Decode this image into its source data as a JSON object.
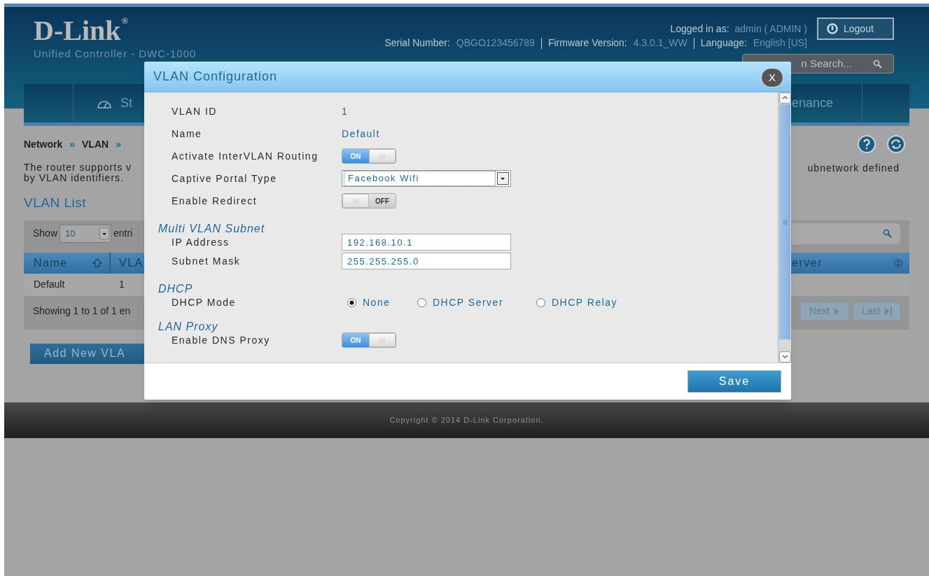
{
  "header": {
    "logo": "D-Link",
    "logo_mark": "®",
    "product": "Unified Controller - DWC-1000",
    "logged_in_label": "Logged in as:",
    "logged_in_value": "admin ( ADMIN )",
    "logout": "Logout",
    "info": [
      {
        "label": "Serial Number:",
        "value": "QBGO123456789"
      },
      {
        "label": "Firmware Version:",
        "value": "4.3.0.1_WW"
      },
      {
        "label": "Language:",
        "value": "English [US]"
      }
    ],
    "search_placeholder": "n Search..."
  },
  "nav": [
    {
      "kind": "left",
      "label": "St"
    },
    {
      "kind": "right",
      "label": "enance"
    }
  ],
  "breadcrumb": [
    "Network",
    "»",
    "VLAN",
    "»"
  ],
  "description": {
    "left_lines": [
      "The router supports v",
      "by VLAN identifiers."
    ],
    "right_line": "ubnetwork defined"
  },
  "list_title": "VLAN List",
  "table": {
    "show_label": "Show",
    "page_size": "10",
    "entries_label": "entri",
    "columns": [
      {
        "label": "Name",
        "kind": "ascending"
      },
      {
        "label": "VLA",
        "kind": "plain"
      },
      {
        "label": "erver",
        "kind": "sortable"
      }
    ],
    "rows": [
      [
        "Default",
        "1"
      ]
    ],
    "info": "Showing 1 to 1 of 1 en",
    "pager": [
      "Next",
      "Last"
    ]
  },
  "add_button": "Add New VLA",
  "modal": {
    "title": "VLAN Configuration",
    "close": "X",
    "fields": [
      {
        "kind": "text",
        "label": "VLAN ID",
        "value": "1"
      },
      {
        "kind": "text",
        "label": "Name",
        "value": "Default"
      },
      {
        "kind": "toggle",
        "label": "Activate InterVLAN Routing",
        "on": true,
        "text": "ON"
      },
      {
        "kind": "select",
        "label": "Captive Portal Type",
        "value": "Facebook Wifi"
      },
      {
        "kind": "toggle",
        "label": "Enable Redirect",
        "on": false,
        "text": "OFF"
      },
      {
        "kind": "section",
        "label": "Multi VLAN Subnet"
      },
      {
        "kind": "input",
        "label": "IP Address",
        "value": "192.168.10.1"
      },
      {
        "kind": "input",
        "label": "Subnet Mask",
        "value": "255.255.255.0"
      },
      {
        "kind": "section",
        "label": "DHCP"
      },
      {
        "kind": "radio",
        "label": "DHCP Mode",
        "options": [
          {
            "label": "None",
            "selected": true
          },
          {
            "label": "DHCP Server",
            "selected": false
          },
          {
            "label": "DHCP Relay",
            "selected": false
          }
        ]
      },
      {
        "kind": "section",
        "label": "LAN Proxy"
      },
      {
        "kind": "toggle",
        "label": "Enable DNS Proxy",
        "on": true,
        "text": "ON"
      }
    ],
    "save": "Save"
  },
  "footer": "Copyright © 2014 D-Link Corporation."
}
